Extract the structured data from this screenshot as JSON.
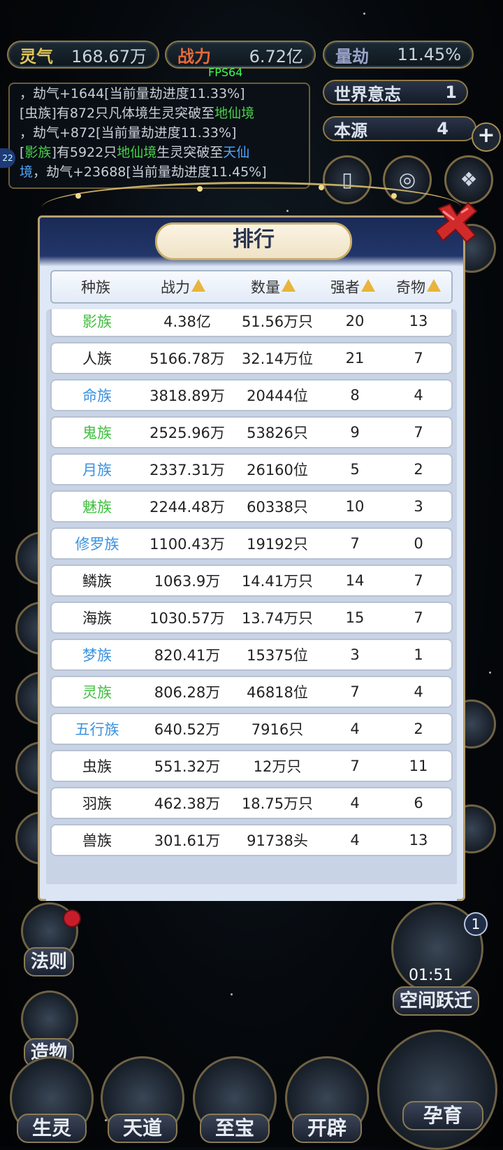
{
  "topbar": {
    "lingqi": {
      "label": "灵气",
      "value": "168.67万"
    },
    "zhanli": {
      "label": "战力",
      "value": "6.72亿"
    },
    "liangjie": {
      "label": "量劫",
      "value": "11.45%"
    },
    "fps": "FPS64"
  },
  "log": [
    {
      "text": "，劫气+1644[当前量劫进度11.33%]"
    },
    {
      "pre": "[虫族]有872只凡体境生灵突破至",
      "hl": "地仙境",
      "post": ""
    },
    {
      "pre": "，劫气+872[当前量劫进度11.33%]"
    },
    {
      "pre": "[",
      "hl": "影族",
      "mid": "]有5922只",
      "hl2": "地仙境",
      "post": "生灵突破至",
      "hl3": "天仙"
    },
    {
      "hl": "境",
      "post": "，劫气+23688[当前量劫进度11.45%]"
    }
  ],
  "side": {
    "world_will": {
      "label": "世界意志",
      "value": "1"
    },
    "origin": {
      "label": "本源",
      "value": "4"
    },
    "plus": "+",
    "left_badge": "22"
  },
  "ranking": {
    "title": "排行",
    "headers": [
      "种族",
      "战力",
      "数量",
      "强者",
      "奇物"
    ],
    "colors": {
      "green": "#3fbf3f",
      "blue": "#3a92e0",
      "black": "#222222"
    },
    "rows": [
      {
        "race": "影族",
        "color": "green",
        "power": "4.38亿",
        "count": "51.56万只",
        "strong": "20",
        "items": "13"
      },
      {
        "race": "人族",
        "color": "black",
        "power": "5166.78万",
        "count": "32.14万位",
        "strong": "21",
        "items": "7"
      },
      {
        "race": "命族",
        "color": "blue",
        "power": "3818.89万",
        "count": "20444位",
        "strong": "8",
        "items": "4"
      },
      {
        "race": "鬼族",
        "color": "green",
        "power": "2525.96万",
        "count": "53826只",
        "strong": "9",
        "items": "7"
      },
      {
        "race": "月族",
        "color": "blue",
        "power": "2337.31万",
        "count": "26160位",
        "strong": "5",
        "items": "2"
      },
      {
        "race": "魅族",
        "color": "green",
        "power": "2244.48万",
        "count": "60338只",
        "strong": "10",
        "items": "3"
      },
      {
        "race": "修罗族",
        "color": "blue",
        "power": "1100.43万",
        "count": "19192只",
        "strong": "7",
        "items": "0"
      },
      {
        "race": "鳞族",
        "color": "black",
        "power": "1063.9万",
        "count": "14.41万只",
        "strong": "14",
        "items": "7"
      },
      {
        "race": "海族",
        "color": "black",
        "power": "1030.57万",
        "count": "13.74万只",
        "strong": "15",
        "items": "7"
      },
      {
        "race": "梦族",
        "color": "blue",
        "power": "820.41万",
        "count": "15375位",
        "strong": "3",
        "items": "1"
      },
      {
        "race": "灵族",
        "color": "green",
        "power": "806.28万",
        "count": "46818位",
        "strong": "7",
        "items": "4"
      },
      {
        "race": "五行族",
        "color": "blue",
        "power": "640.52万",
        "count": "7916只",
        "strong": "4",
        "items": "2"
      },
      {
        "race": "虫族",
        "color": "black",
        "power": "551.32万",
        "count": "12万只",
        "strong": "7",
        "items": "11"
      },
      {
        "race": "羽族",
        "color": "black",
        "power": "462.38万",
        "count": "18.75万只",
        "strong": "4",
        "items": "6"
      },
      {
        "race": "兽族",
        "color": "black",
        "power": "301.61万",
        "count": "91738头",
        "strong": "4",
        "items": "13"
      }
    ]
  },
  "bottom": {
    "law": "法则",
    "create": "造物",
    "space_jump": "空间跃迁",
    "timer": "01:51",
    "jump_badge": "1",
    "buttons": [
      "生灵",
      "天道",
      "至宝",
      "开辟"
    ],
    "nurture": "孕育"
  }
}
